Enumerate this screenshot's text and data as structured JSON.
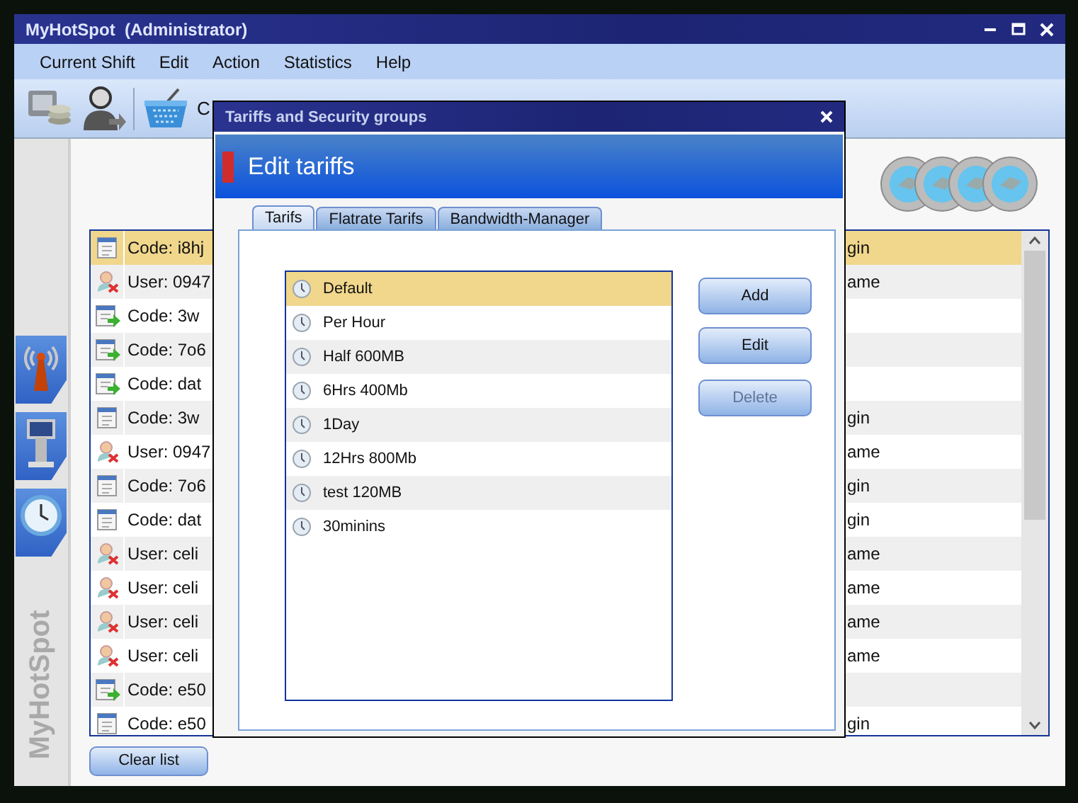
{
  "window": {
    "title": "MyHotSpot  (Administrator)"
  },
  "menu": [
    "Current Shift",
    "Edit",
    "Action",
    "Statistics",
    "Help"
  ],
  "toolbar": {
    "label": "C"
  },
  "sidebar": {
    "brand": "MyHotSpot"
  },
  "sessions": [
    {
      "kind": "code",
      "left": "Code: i8hj",
      "right": "gin",
      "selected": true
    },
    {
      "kind": "user",
      "left": "User: 0947",
      "right": "ame",
      "selected": false
    },
    {
      "kind": "code-arrow",
      "left": "Code: 3w",
      "selected": false
    },
    {
      "kind": "code-arrow",
      "left": "Code: 7o6",
      "selected": false
    },
    {
      "kind": "code-arrow",
      "left": "Code: dat",
      "selected": false
    },
    {
      "kind": "code",
      "left": "Code: 3w",
      "right": "gin",
      "selected": false
    },
    {
      "kind": "user",
      "left": "User: 0947",
      "right": "ame",
      "selected": false
    },
    {
      "kind": "code",
      "left": "Code: 7o6",
      "right": "gin",
      "selected": false
    },
    {
      "kind": "code",
      "left": "Code: dat",
      "right": "gin",
      "selected": false
    },
    {
      "kind": "user",
      "left": "User: celi",
      "right": "ame",
      "selected": false
    },
    {
      "kind": "user",
      "left": "User: celi",
      "right": "ame",
      "selected": false
    },
    {
      "kind": "user",
      "left": "User: celi",
      "right": "ame",
      "selected": false
    },
    {
      "kind": "user",
      "left": "User: celi",
      "right": "ame",
      "selected": false
    },
    {
      "kind": "code-arrow",
      "left": "Code: e50",
      "selected": false
    },
    {
      "kind": "code",
      "left": "Code: e50",
      "right": "gin",
      "selected": false
    }
  ],
  "clear_button": "Clear list",
  "dialog": {
    "title": "Tariffs and Security groups",
    "heading": "Edit tariffs",
    "tabs": [
      {
        "label": "Tarifs",
        "selected": true
      },
      {
        "label": "Flatrate Tarifs",
        "selected": false
      },
      {
        "label": "Bandwidth-Manager",
        "selected": false
      }
    ],
    "tariffs": [
      {
        "name": "Default",
        "selected": true
      },
      {
        "name": "Per Hour",
        "selected": false
      },
      {
        "name": "Half 600MB",
        "selected": false
      },
      {
        "name": "6Hrs 400Mb",
        "selected": false
      },
      {
        "name": "1Day",
        "selected": false
      },
      {
        "name": "12Hrs 800Mb",
        "selected": false
      },
      {
        "name": "test 120MB",
        "selected": false
      },
      {
        "name": "30minins",
        "selected": false
      }
    ],
    "buttons": [
      {
        "label": "Add",
        "disabled": false
      },
      {
        "label": "Edit",
        "disabled": false
      },
      {
        "label": "Delete",
        "disabled": true
      }
    ]
  }
}
